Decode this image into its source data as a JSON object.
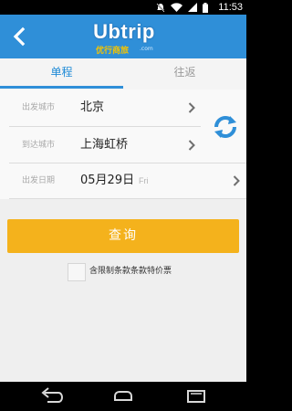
{
  "status_bar": {
    "time": "11:53",
    "icons": [
      "notification-off-icon",
      "wifi-icon",
      "cell-signal-icon",
      "battery-icon"
    ]
  },
  "header": {
    "logo_text": "Ubtrip",
    "logo_subtitle": "优行商旅",
    "logo_domain": ".com",
    "background_color": "#2f8fd8"
  },
  "tabs": [
    {
      "label": "单程",
      "active": true
    },
    {
      "label": "往返",
      "active": false
    }
  ],
  "form": {
    "departure_city": {
      "label": "出发城市",
      "value": "北京"
    },
    "arrival_city": {
      "label": "到达城市",
      "value": "上海虹桥"
    },
    "departure_date": {
      "label": "出发日期",
      "value": "05月29日",
      "weekday": "Fri"
    }
  },
  "search_button": {
    "label": "查询",
    "color": "#f4b21c"
  },
  "restricted_fares": {
    "label": "含限制条款条款特价票",
    "checked": false
  },
  "nav_bar": {
    "buttons": [
      "back-icon",
      "home-icon",
      "recents-icon"
    ]
  }
}
